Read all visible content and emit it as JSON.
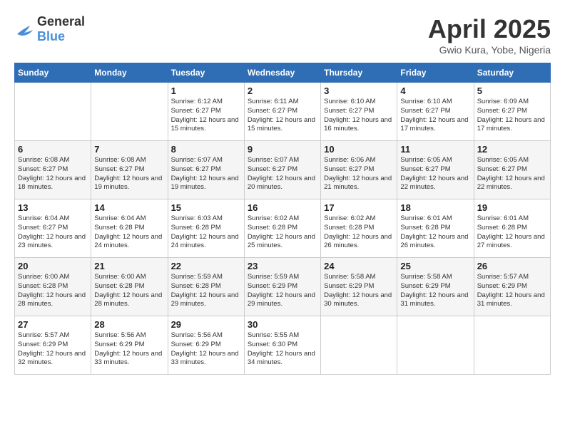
{
  "logo": {
    "general": "General",
    "blue": "Blue"
  },
  "title": "April 2025",
  "location": "Gwio Kura, Yobe, Nigeria",
  "days_of_week": [
    "Sunday",
    "Monday",
    "Tuesday",
    "Wednesday",
    "Thursday",
    "Friday",
    "Saturday"
  ],
  "weeks": [
    [
      {
        "day": "",
        "sunrise": "",
        "sunset": "",
        "daylight": ""
      },
      {
        "day": "",
        "sunrise": "",
        "sunset": "",
        "daylight": ""
      },
      {
        "day": "1",
        "sunrise": "Sunrise: 6:12 AM",
        "sunset": "Sunset: 6:27 PM",
        "daylight": "Daylight: 12 hours and 15 minutes."
      },
      {
        "day": "2",
        "sunrise": "Sunrise: 6:11 AM",
        "sunset": "Sunset: 6:27 PM",
        "daylight": "Daylight: 12 hours and 15 minutes."
      },
      {
        "day": "3",
        "sunrise": "Sunrise: 6:10 AM",
        "sunset": "Sunset: 6:27 PM",
        "daylight": "Daylight: 12 hours and 16 minutes."
      },
      {
        "day": "4",
        "sunrise": "Sunrise: 6:10 AM",
        "sunset": "Sunset: 6:27 PM",
        "daylight": "Daylight: 12 hours and 17 minutes."
      },
      {
        "day": "5",
        "sunrise": "Sunrise: 6:09 AM",
        "sunset": "Sunset: 6:27 PM",
        "daylight": "Daylight: 12 hours and 17 minutes."
      }
    ],
    [
      {
        "day": "6",
        "sunrise": "Sunrise: 6:08 AM",
        "sunset": "Sunset: 6:27 PM",
        "daylight": "Daylight: 12 hours and 18 minutes."
      },
      {
        "day": "7",
        "sunrise": "Sunrise: 6:08 AM",
        "sunset": "Sunset: 6:27 PM",
        "daylight": "Daylight: 12 hours and 19 minutes."
      },
      {
        "day": "8",
        "sunrise": "Sunrise: 6:07 AM",
        "sunset": "Sunset: 6:27 PM",
        "daylight": "Daylight: 12 hours and 19 minutes."
      },
      {
        "day": "9",
        "sunrise": "Sunrise: 6:07 AM",
        "sunset": "Sunset: 6:27 PM",
        "daylight": "Daylight: 12 hours and 20 minutes."
      },
      {
        "day": "10",
        "sunrise": "Sunrise: 6:06 AM",
        "sunset": "Sunset: 6:27 PM",
        "daylight": "Daylight: 12 hours and 21 minutes."
      },
      {
        "day": "11",
        "sunrise": "Sunrise: 6:05 AM",
        "sunset": "Sunset: 6:27 PM",
        "daylight": "Daylight: 12 hours and 22 minutes."
      },
      {
        "day": "12",
        "sunrise": "Sunrise: 6:05 AM",
        "sunset": "Sunset: 6:27 PM",
        "daylight": "Daylight: 12 hours and 22 minutes."
      }
    ],
    [
      {
        "day": "13",
        "sunrise": "Sunrise: 6:04 AM",
        "sunset": "Sunset: 6:27 PM",
        "daylight": "Daylight: 12 hours and 23 minutes."
      },
      {
        "day": "14",
        "sunrise": "Sunrise: 6:04 AM",
        "sunset": "Sunset: 6:28 PM",
        "daylight": "Daylight: 12 hours and 24 minutes."
      },
      {
        "day": "15",
        "sunrise": "Sunrise: 6:03 AM",
        "sunset": "Sunset: 6:28 PM",
        "daylight": "Daylight: 12 hours and 24 minutes."
      },
      {
        "day": "16",
        "sunrise": "Sunrise: 6:02 AM",
        "sunset": "Sunset: 6:28 PM",
        "daylight": "Daylight: 12 hours and 25 minutes."
      },
      {
        "day": "17",
        "sunrise": "Sunrise: 6:02 AM",
        "sunset": "Sunset: 6:28 PM",
        "daylight": "Daylight: 12 hours and 26 minutes."
      },
      {
        "day": "18",
        "sunrise": "Sunrise: 6:01 AM",
        "sunset": "Sunset: 6:28 PM",
        "daylight": "Daylight: 12 hours and 26 minutes."
      },
      {
        "day": "19",
        "sunrise": "Sunrise: 6:01 AM",
        "sunset": "Sunset: 6:28 PM",
        "daylight": "Daylight: 12 hours and 27 minutes."
      }
    ],
    [
      {
        "day": "20",
        "sunrise": "Sunrise: 6:00 AM",
        "sunset": "Sunset: 6:28 PM",
        "daylight": "Daylight: 12 hours and 28 minutes."
      },
      {
        "day": "21",
        "sunrise": "Sunrise: 6:00 AM",
        "sunset": "Sunset: 6:28 PM",
        "daylight": "Daylight: 12 hours and 28 minutes."
      },
      {
        "day": "22",
        "sunrise": "Sunrise: 5:59 AM",
        "sunset": "Sunset: 6:28 PM",
        "daylight": "Daylight: 12 hours and 29 minutes."
      },
      {
        "day": "23",
        "sunrise": "Sunrise: 5:59 AM",
        "sunset": "Sunset: 6:29 PM",
        "daylight": "Daylight: 12 hours and 29 minutes."
      },
      {
        "day": "24",
        "sunrise": "Sunrise: 5:58 AM",
        "sunset": "Sunset: 6:29 PM",
        "daylight": "Daylight: 12 hours and 30 minutes."
      },
      {
        "day": "25",
        "sunrise": "Sunrise: 5:58 AM",
        "sunset": "Sunset: 6:29 PM",
        "daylight": "Daylight: 12 hours and 31 minutes."
      },
      {
        "day": "26",
        "sunrise": "Sunrise: 5:57 AM",
        "sunset": "Sunset: 6:29 PM",
        "daylight": "Daylight: 12 hours and 31 minutes."
      }
    ],
    [
      {
        "day": "27",
        "sunrise": "Sunrise: 5:57 AM",
        "sunset": "Sunset: 6:29 PM",
        "daylight": "Daylight: 12 hours and 32 minutes."
      },
      {
        "day": "28",
        "sunrise": "Sunrise: 5:56 AM",
        "sunset": "Sunset: 6:29 PM",
        "daylight": "Daylight: 12 hours and 33 minutes."
      },
      {
        "day": "29",
        "sunrise": "Sunrise: 5:56 AM",
        "sunset": "Sunset: 6:29 PM",
        "daylight": "Daylight: 12 hours and 33 minutes."
      },
      {
        "day": "30",
        "sunrise": "Sunrise: 5:55 AM",
        "sunset": "Sunset: 6:30 PM",
        "daylight": "Daylight: 12 hours and 34 minutes."
      },
      {
        "day": "",
        "sunrise": "",
        "sunset": "",
        "daylight": ""
      },
      {
        "day": "",
        "sunrise": "",
        "sunset": "",
        "daylight": ""
      },
      {
        "day": "",
        "sunrise": "",
        "sunset": "",
        "daylight": ""
      }
    ]
  ]
}
